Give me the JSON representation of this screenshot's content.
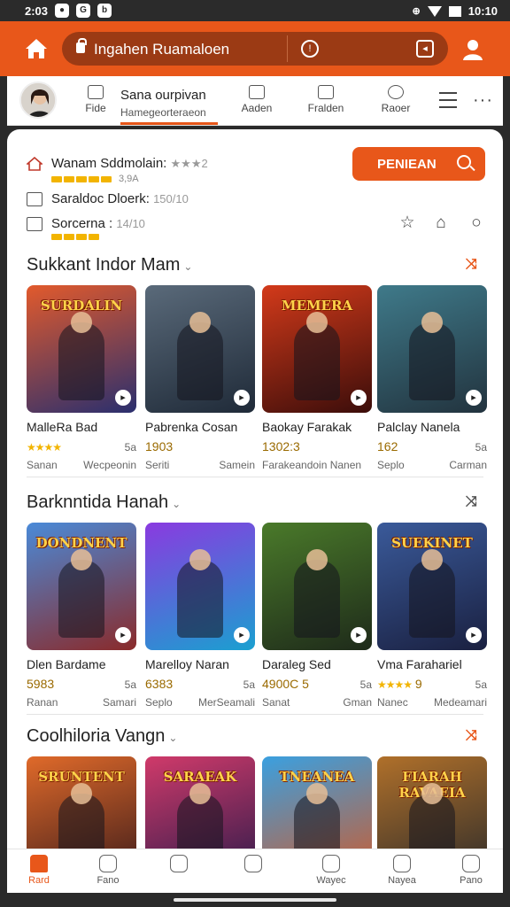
{
  "status_bar": {
    "time": "2:03",
    "right_time": "10:10"
  },
  "app_bar": {
    "url": "Ingahen Ruamaloen"
  },
  "tabs": {
    "active": {
      "title": "Sana ourpivan",
      "subtitle": "Hamegeorteraeon"
    },
    "items": [
      {
        "label": "Fide"
      },
      {
        "label": "Aaden"
      },
      {
        "label": "Fralden"
      },
      {
        "label": "Raoer"
      }
    ]
  },
  "header": {
    "cta_label": "PENIEAN",
    "rows": [
      {
        "text": "Wanam Sddmolain:",
        "muted": "★★★2",
        "dots_label": "3,9A",
        "dots": 5
      },
      {
        "text": "Saraldoc Dloerk:",
        "muted": "150/10"
      },
      {
        "text": "Sorcerna :",
        "muted": "14/10",
        "dots": 4
      }
    ]
  },
  "sections": [
    {
      "title": "Sukkant Indor Mam",
      "action_icon": "collapse-arrows-icon",
      "cards": [
        {
          "thumb_title": "SURDALIN",
          "bg": [
            "#e25a2c",
            "#2a2f6e"
          ],
          "name": "MalleRa Bad",
          "score": "★★★★",
          "score_is_stars": true,
          "side": "5a",
          "sub1": "Sanan",
          "sub2": "Wecpeonin"
        },
        {
          "thumb_title": "",
          "bg": [
            "#5a6a7a",
            "#1f2a38"
          ],
          "name": "Pabrenka Cosan",
          "score": "1903",
          "side": "",
          "sub1": "Seriti",
          "sub2": "Samein"
        },
        {
          "thumb_title": "MEMERA",
          "bg": [
            "#d33a1a",
            "#3b0d0a"
          ],
          "name": "Baokay Farakak",
          "score": "1302:3",
          "side": "",
          "sub1": "Farakeandoin Nanen",
          "sub2": ""
        },
        {
          "thumb_title": "",
          "bg": [
            "#3f7a8a",
            "#22333e"
          ],
          "name": "Palclay Nanela",
          "score": "162",
          "side": "5a",
          "sub1": "Seplo",
          "sub2": "Carman"
        }
      ]
    },
    {
      "title": "Barknntida Hanah",
      "action_icon": "collapse-arrows-icon",
      "cards": [
        {
          "thumb_title": "DONDNENT",
          "bg": [
            "#4a8ad8",
            "#8a2a2a"
          ],
          "name": "Dlen Bardame",
          "score": "5983",
          "side": "5a",
          "sub1": "Ranan",
          "sub2": "Samari"
        },
        {
          "thumb_title": "",
          "bg": [
            "#8a3ae0",
            "#1aa0d0"
          ],
          "name": "Marelloy Naran",
          "score": "6383",
          "side": "5a",
          "sub1": "Seplo",
          "sub2": "MerSeamali"
        },
        {
          "thumb_title": "",
          "bg": [
            "#4a7a2a",
            "#1e2a1a"
          ],
          "name": "Daraleg Sed",
          "score": "4900C 5",
          "side": "5a",
          "sub1": "Sanat",
          "sub2": "Gman"
        },
        {
          "thumb_title": "SUEKINET",
          "bg": [
            "#3a5a9a",
            "#1a2040"
          ],
          "name": "Vma Farahariel",
          "score": "★★★★ 9",
          "score_is_stars": true,
          "side": "5a",
          "sub1": "Nanec",
          "sub2": "Medeamari"
        }
      ]
    },
    {
      "title": "Coolhiloria Vangn",
      "action_icon": "collapse-arrows-icon",
      "cards": [
        {
          "thumb_title": "SRUNTENT",
          "bg": [
            "#e06a2a",
            "#3a1a1a"
          ],
          "name": "",
          "score": "",
          "side": "",
          "sub1": "",
          "sub2": ""
        },
        {
          "thumb_title": "SARAEAK",
          "bg": [
            "#d03a6a",
            "#2a1a4a"
          ],
          "name": "",
          "score": "",
          "side": "",
          "sub1": "",
          "sub2": ""
        },
        {
          "thumb_title": "TNEANEA",
          "bg": [
            "#3aa0e0",
            "#d05a2a"
          ],
          "name": "",
          "score": "",
          "side": "",
          "sub1": "",
          "sub2": ""
        },
        {
          "thumb_title": "FIARAH RAVAEIA",
          "bg": [
            "#b0702a",
            "#2a2a2a"
          ],
          "name": "",
          "score": "",
          "side": "",
          "sub1": "",
          "sub2": ""
        }
      ]
    }
  ],
  "bottom_nav": [
    {
      "label": "Rard",
      "active": true
    },
    {
      "label": "Fano"
    },
    {
      "label": ""
    },
    {
      "label": ""
    },
    {
      "label": "Wayec"
    },
    {
      "label": "Nayea"
    },
    {
      "label": "Pano"
    }
  ],
  "colors": {
    "accent": "#e8571a",
    "star": "#f2b400"
  }
}
